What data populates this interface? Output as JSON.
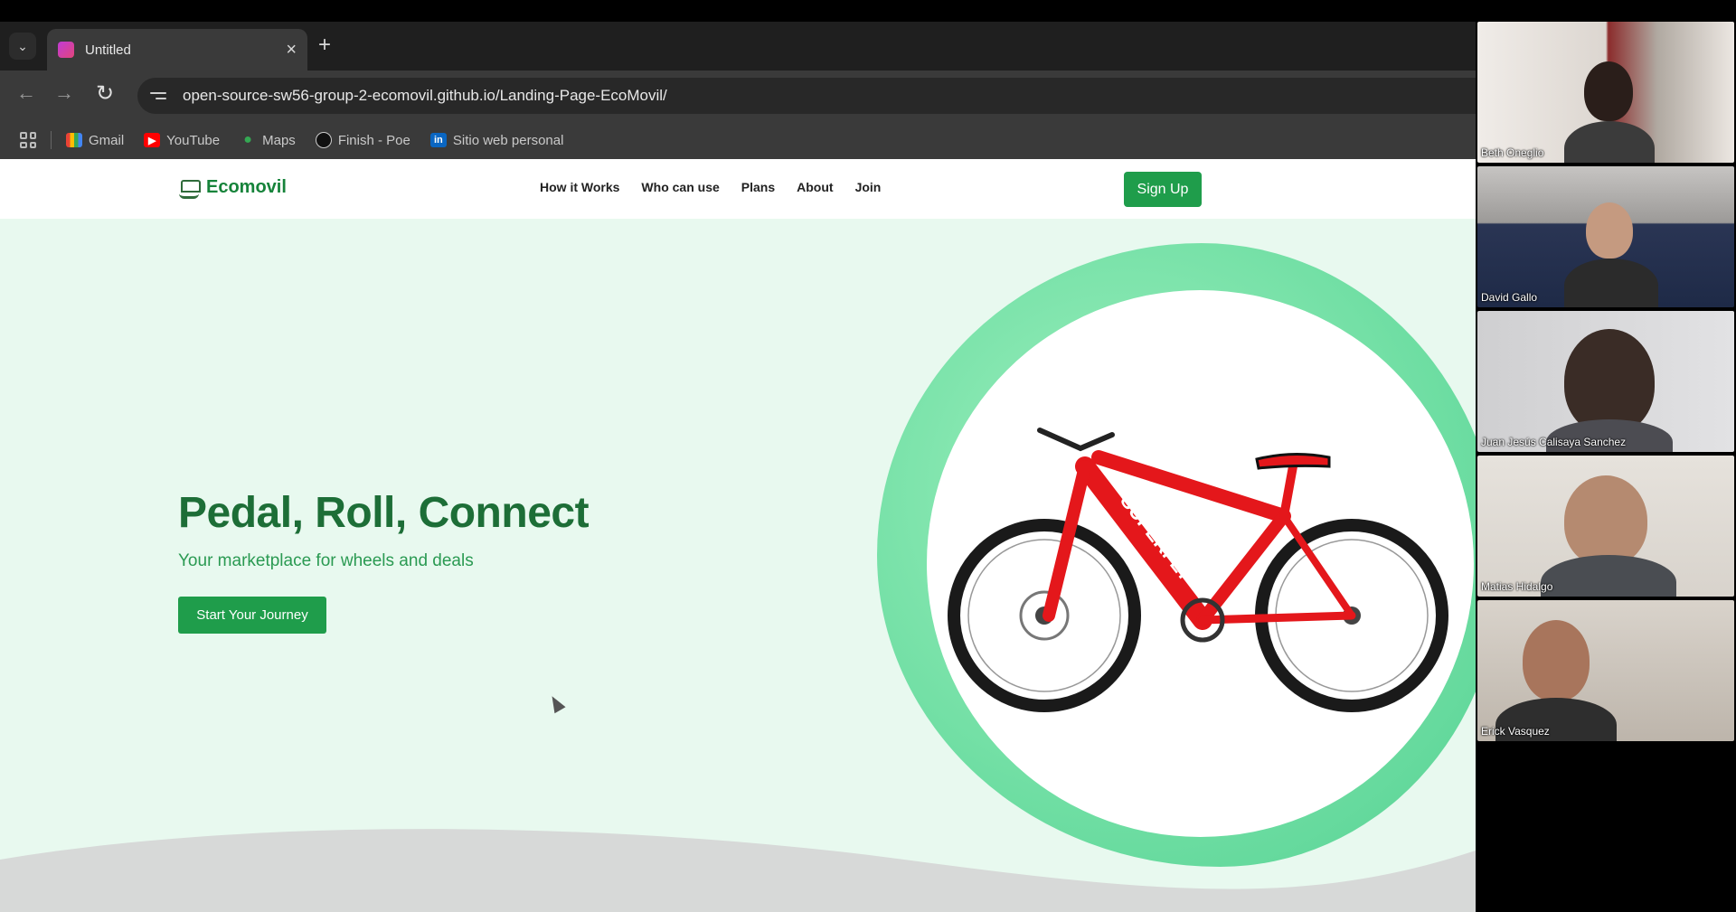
{
  "browser": {
    "tab": {
      "title": "Untitled",
      "close_glyph": "×"
    },
    "new_tab_glyph": "+",
    "url": "open-source-sw56-group-2-ecomovil.github.io/Landing-Page-EcoMovil/",
    "bookmarks": [
      {
        "label": "Gmail",
        "icon": "gmail-icon"
      },
      {
        "label": "YouTube",
        "icon": "youtube-icon"
      },
      {
        "label": "Maps",
        "icon": "maps-icon"
      },
      {
        "label": "Finish - Poe",
        "icon": "poe-icon"
      },
      {
        "label": "Sitio web personal",
        "icon": "linkedin-icon"
      }
    ]
  },
  "site": {
    "brand": "Ecomovil",
    "nav": [
      "How it Works",
      "Who can use",
      "Plans",
      "About",
      "Join"
    ],
    "signup_label": "Sign Up",
    "hero": {
      "title": "Pedal, Roll, Connect",
      "subtitle": "Your marketplace for wheels and deals",
      "cta_label": "Start Your Journey"
    },
    "bike_brand": "SUPERFLY",
    "colors": {
      "primary": "#1f9d4b",
      "heading": "#1d6e37",
      "hero_bg": "#e8f9ef",
      "blob": "#6fdea3"
    }
  },
  "participants": [
    {
      "name": "Beth Oneglio"
    },
    {
      "name": "David Gallo"
    },
    {
      "name": "Juan Jesús Calisaya Sanchez"
    },
    {
      "name": "Matias Hidalgo"
    },
    {
      "name": "Erick Vasquez"
    }
  ]
}
